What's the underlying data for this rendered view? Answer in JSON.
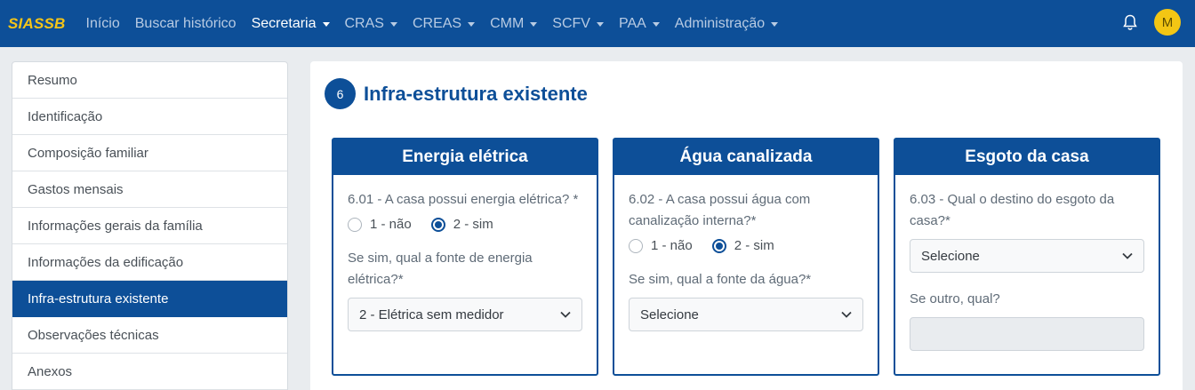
{
  "navbar": {
    "brand": "SIASSB",
    "items": [
      {
        "label": "Início",
        "dropdown": false,
        "active": false
      },
      {
        "label": "Buscar histórico",
        "dropdown": false,
        "active": false
      },
      {
        "label": "Secretaria",
        "dropdown": true,
        "active": true
      },
      {
        "label": "CRAS",
        "dropdown": true,
        "active": false
      },
      {
        "label": "CREAS",
        "dropdown": true,
        "active": false
      },
      {
        "label": "CMM",
        "dropdown": true,
        "active": false
      },
      {
        "label": "SCFV",
        "dropdown": true,
        "active": false
      },
      {
        "label": "PAA",
        "dropdown": true,
        "active": false
      },
      {
        "label": "Administração",
        "dropdown": true,
        "active": false
      }
    ],
    "bell_icon": "bell-icon",
    "avatar_initial": "M"
  },
  "sidebar": {
    "items": [
      "Resumo",
      "Identificação",
      "Composição familiar",
      "Gastos mensais",
      "Informações gerais da família",
      "Informações da edificação",
      "Infra-estrutura existente",
      "Observações técnicas",
      "Anexos"
    ],
    "active_index": 6
  },
  "section": {
    "number": "6",
    "title": "Infra-estrutura existente"
  },
  "cards": {
    "energia": {
      "title": "Energia elétrica",
      "question": "6.01 - A casa possui energia elétrica? *",
      "option_no": "1 - não",
      "option_yes": "2 - sim",
      "selected": "2 - sim",
      "followup_label": "Se sim, qual a fonte de energia elétrica?*",
      "followup_value": "2 - Elétrica sem medidor"
    },
    "agua": {
      "title": "Água canalizada",
      "question": "6.02 - A casa possui água com canalização interna?*",
      "option_no": "1 - não",
      "option_yes": "2 - sim",
      "selected": "2 - sim",
      "followup_label": "Se sim, qual a fonte da água?*",
      "followup_value": "Selecione"
    },
    "esgoto": {
      "title": "Esgoto da casa",
      "question": "6.03 - Qual o destino do esgoto da casa?*",
      "select_value": "Selecione",
      "other_label": "Se outro, qual?",
      "other_value": ""
    }
  },
  "colors": {
    "primary": "#0d4f98",
    "brand": "#f5c518",
    "avatar": "#f3c614"
  }
}
